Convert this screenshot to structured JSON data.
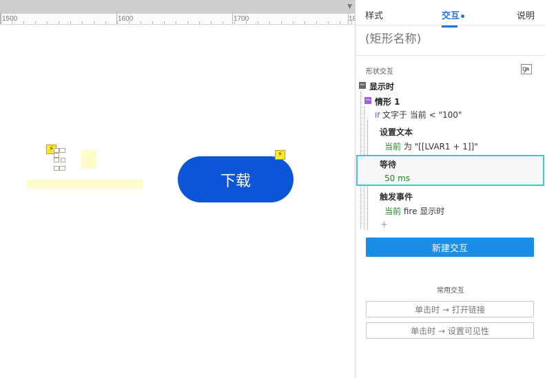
{
  "ruler": {
    "labels": [
      "1500",
      "1600",
      "1700",
      "18"
    ]
  },
  "canvas": {
    "button_label": "下载",
    "bolt_glyph": "⚡",
    "scroll_arrow_glyph": "▼"
  },
  "colors": {
    "accent": "#1a78d8",
    "button_primary": "#0b55d6",
    "new_interaction_bg": "#1a8ee6",
    "highlight_border": "#3fc6d4",
    "action_target_green": "#1a8c1a"
  },
  "tabs": [
    {
      "label": "样式",
      "active": false
    },
    {
      "label": "交互",
      "active": true,
      "has_dot": true
    },
    {
      "label": "说明",
      "active": false
    }
  ],
  "panel": {
    "shape_name_placeholder": "(矩形名称)",
    "section_title": "形状交互",
    "collapse_icon": "collapse-icon",
    "event": {
      "label": "显示时",
      "case": {
        "label": "情形 1",
        "condition": {
          "keyword": "If",
          "text": "文字于 当前 < \"100\""
        },
        "actions": [
          {
            "title": "设置文本",
            "target": "当前",
            "detail": "为 \"[[LVAR1 + 1]]\""
          },
          {
            "title": "等待",
            "target": "50 ms",
            "detail": ""
          },
          {
            "title": "触发事件",
            "target": "当前",
            "detail": "fire 显示时"
          }
        ]
      }
    },
    "add_glyph": "+",
    "new_interaction_label": "新建交互",
    "common_title": "常用交互",
    "common_actions": [
      "单击时 → 打开链接",
      "单击时 → 设置可见性"
    ]
  }
}
